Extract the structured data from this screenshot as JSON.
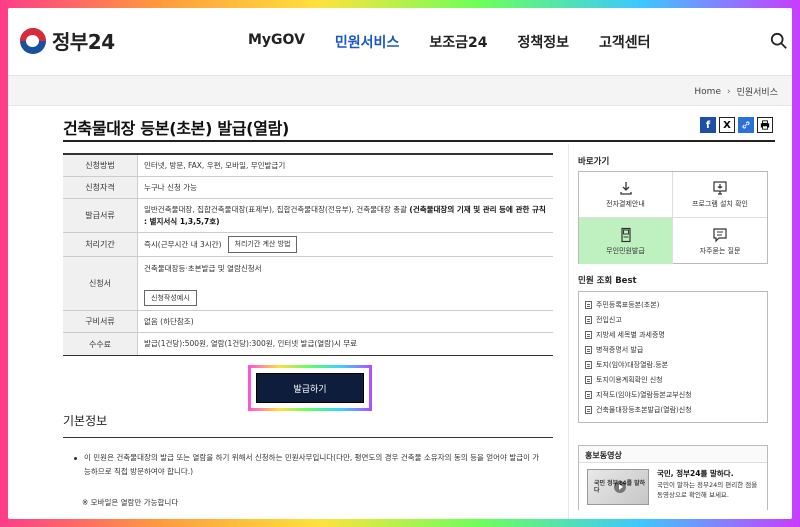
{
  "header": {
    "logo_text": "정부24",
    "nav": [
      "MyGOV",
      "민원서비스",
      "보조금24",
      "정책정보",
      "고객센터"
    ],
    "active_nav": "민원서비스"
  },
  "breadcrumb": {
    "home": "Home",
    "current": "민원서비스"
  },
  "page": {
    "title": "건축물대장 등본(초본) 발급(열람)",
    "share": {
      "facebook": "f",
      "x": "X",
      "link": "🔗",
      "print": "🖶"
    }
  },
  "info": {
    "method": {
      "label": "신청방법",
      "value": "인터넷, 방문, FAX, 우편, 모바일, 무인발급기"
    },
    "eligibility": {
      "label": "신청자격",
      "value": "누구나 신청 가능"
    },
    "docs": {
      "label": "발급서류",
      "value": "일반건축물대장, 집합건축물대장(표제부), 집합건축물대장(전유부), 건축물대장 총괄",
      "strong": "(건축물대장의 기재 및 관리 등에 관한 규칙 : 별지서식 1,3,5,7호)"
    },
    "period": {
      "label": "처리기간",
      "value": "즉시(근무시간 내 3시간)",
      "button": "처리기간 계산 방법"
    },
    "form": {
      "label": "신청서",
      "value": "건축물대장등·초본발급 및 열람신청서",
      "button": "신청작성예시"
    },
    "required": {
      "label": "구비서류",
      "value": "없음 (하단참조)"
    },
    "fee": {
      "label": "수수료",
      "value": "발급(1건당):500원, 열람(1건당):300원, 인터넷 발급(열람)시 무료"
    },
    "apply_button": "발급하기"
  },
  "basic": {
    "title": "기본정보",
    "bullet": "이 민원은 건축물대장의 발급 또는 열람을 하기 위해서 신청하는 민원사무입니다(다만, 평면도의 경우 건축물 소유자의 동의 등을 얻어야 발급이 가능하므로 직접 방문하여야 합니다.)",
    "note": "※ 모바일은 열람만 가능합니다"
  },
  "sidebar": {
    "quick_title": "바로가기",
    "quick": [
      {
        "label": "전자결제안내",
        "icon": "download-icon"
      },
      {
        "label": "프로그램 설치 확인",
        "icon": "monitor-download-icon"
      },
      {
        "label": "무인민원발급",
        "icon": "kiosk-icon"
      },
      {
        "label": "자주묻는 질문",
        "icon": "chat-icon"
      }
    ],
    "best_title": "민원 조회 Best",
    "best": [
      "주민등록표등본(초본)",
      "전입신고",
      "지방세 세목별 과세증명",
      "병적증명서 발급",
      "토지(임야)대장열람.등본",
      "토지이용계획확인 신청",
      "지적도(임야도)열람등본교부신청",
      "건축물대장등초본발급(열람)신청"
    ],
    "promo_title": "홍보동영상",
    "promo_heading": "국민, 정부24를 말하다.",
    "promo_body": "국민이 말하는 정부24의 편리한 점을 동영상으로 확인해 보세요.",
    "promo_thumb": "국민 정부24를 말하다"
  }
}
